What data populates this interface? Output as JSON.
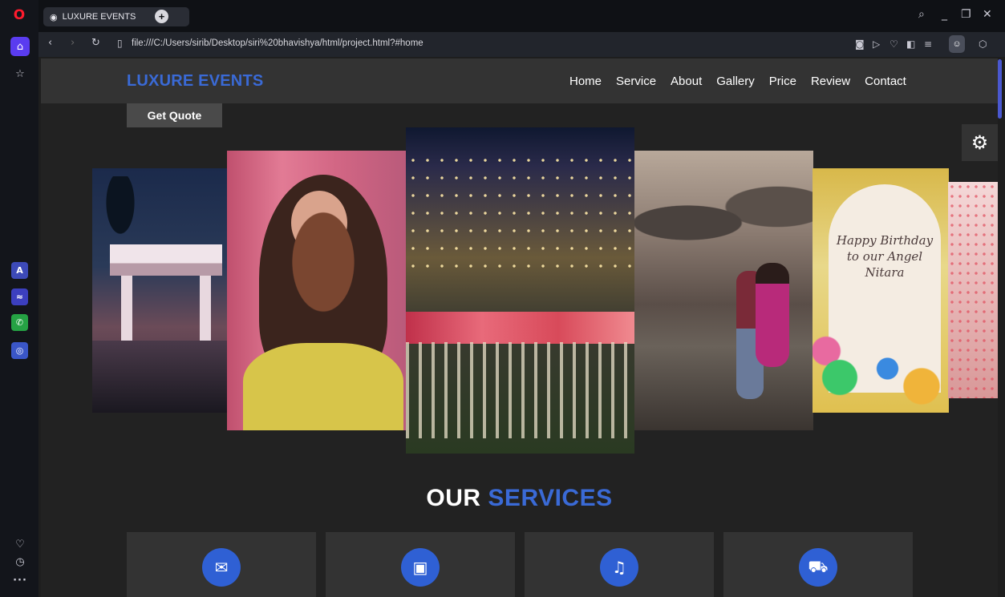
{
  "browser": {
    "tab_title": "LUXURE EVENTS",
    "url": "file:///C:/Users/sirib/Desktop/siri%20bhavishya/html/project.html?#home",
    "new_tab_label": "+"
  },
  "site": {
    "logo": "LUXURE EVENTS",
    "nav": [
      "Home",
      "Service",
      "About",
      "Gallery",
      "Price",
      "Review",
      "Contact"
    ],
    "quote_button": "Get Quote",
    "gallery_birthday_text": "Happy Birthday to our Angel Nitara"
  },
  "services": {
    "title_main": "OUR",
    "title_accent": "SERVICES",
    "cards": [
      {
        "icon": "envelope-icon",
        "glyph": "✉"
      },
      {
        "icon": "images-icon",
        "glyph": "▣"
      },
      {
        "icon": "music-icon",
        "glyph": "♫"
      },
      {
        "icon": "car-icon",
        "glyph": "⛟"
      }
    ]
  },
  "colors": {
    "accent": "#3a6ad6",
    "header_bg": "#333333",
    "page_bg": "#222222",
    "icon_circle": "#2f60d4"
  }
}
